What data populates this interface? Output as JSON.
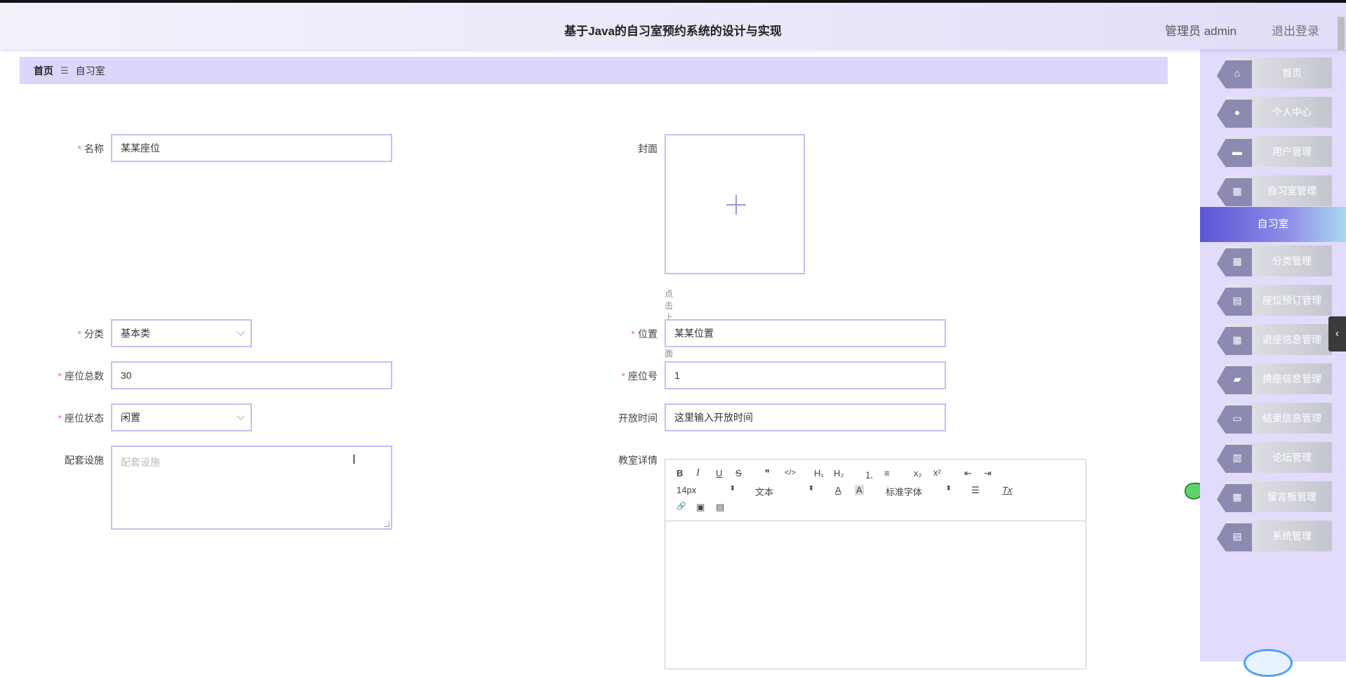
{
  "header": {
    "title": "基于Java的自习室预约系统的设计与实现",
    "user": "管理员 admin",
    "logout": "退出登录"
  },
  "breadcrumb": {
    "home": "首页",
    "separator": "☰",
    "current": "自习室"
  },
  "form": {
    "name": {
      "label": "名称",
      "value": "某某座位",
      "required": true
    },
    "cover": {
      "label": "封面",
      "tip": "点击上传封面"
    },
    "category": {
      "label": "分类",
      "value": "基本类",
      "required": true
    },
    "location": {
      "label": "位置",
      "value": "某某位置",
      "required": true
    },
    "seat_total": {
      "label": "座位总数",
      "value": "30",
      "required": true
    },
    "seat_no": {
      "label": "座位号",
      "value": "1",
      "required": true
    },
    "seat_status": {
      "label": "座位状态",
      "value": "闲置",
      "required": true
    },
    "open_time": {
      "label": "开放时间",
      "value": "这里输入开放时间"
    },
    "facilities": {
      "label": "配套设施",
      "placeholder": "配套设施"
    },
    "details": {
      "label": "教室详情"
    },
    "required_mark": "*"
  },
  "editor": {
    "font_size": "14px",
    "block_type": "文本",
    "font_family": "标准字体",
    "buttons": {
      "bold": "B",
      "italic": "I",
      "underline": "U",
      "strike": "S",
      "quote": "❞",
      "code": "</>",
      "h1": "H₁",
      "h2": "H₂",
      "ol": "⒈",
      "ul": "≡",
      "sub": "x₂",
      "sup": "x²",
      "outdent": "⇤",
      "indent": "⇥",
      "color": "A",
      "bg": "A",
      "align": "☰",
      "clean": "Tx",
      "link": "🔗",
      "image": "▣",
      "video": "▤"
    }
  },
  "sidebar": {
    "items": [
      {
        "label": "首页",
        "icon": "home-icon",
        "glyph": "⌂"
      },
      {
        "label": "个人中心",
        "icon": "user-icon",
        "glyph": "●"
      },
      {
        "label": "用户管理",
        "icon": "briefcase-icon",
        "glyph": "▬"
      },
      {
        "label": "自习室管理",
        "icon": "grid-icon",
        "glyph": "▦"
      },
      {
        "label": "分类管理",
        "icon": "grid-icon",
        "glyph": "▦"
      },
      {
        "label": "座位预订管理",
        "icon": "clipboard-icon",
        "glyph": "▤"
      },
      {
        "label": "退座信息管理",
        "icon": "table-icon",
        "glyph": "▦"
      },
      {
        "label": "换座信息管理",
        "icon": "ticket-icon",
        "glyph": "▰"
      },
      {
        "label": "结束信息管理",
        "icon": "chat-icon",
        "glyph": "▭"
      },
      {
        "label": "论坛管理",
        "icon": "book-icon",
        "glyph": "▥"
      },
      {
        "label": "留言板管理",
        "icon": "grid-icon",
        "glyph": "▦"
      },
      {
        "label": "系统管理",
        "icon": "clipboard-icon",
        "glyph": "▤"
      }
    ],
    "active": "自习室"
  },
  "collapse_glyph": "‹",
  "colors": {
    "accent": "#5b55d4",
    "field_border": "#c6bff0",
    "required": "#f56c6c",
    "sidebar_bg": "#e2dbfb",
    "breadcrumb_bg": "#dcd6fa"
  }
}
